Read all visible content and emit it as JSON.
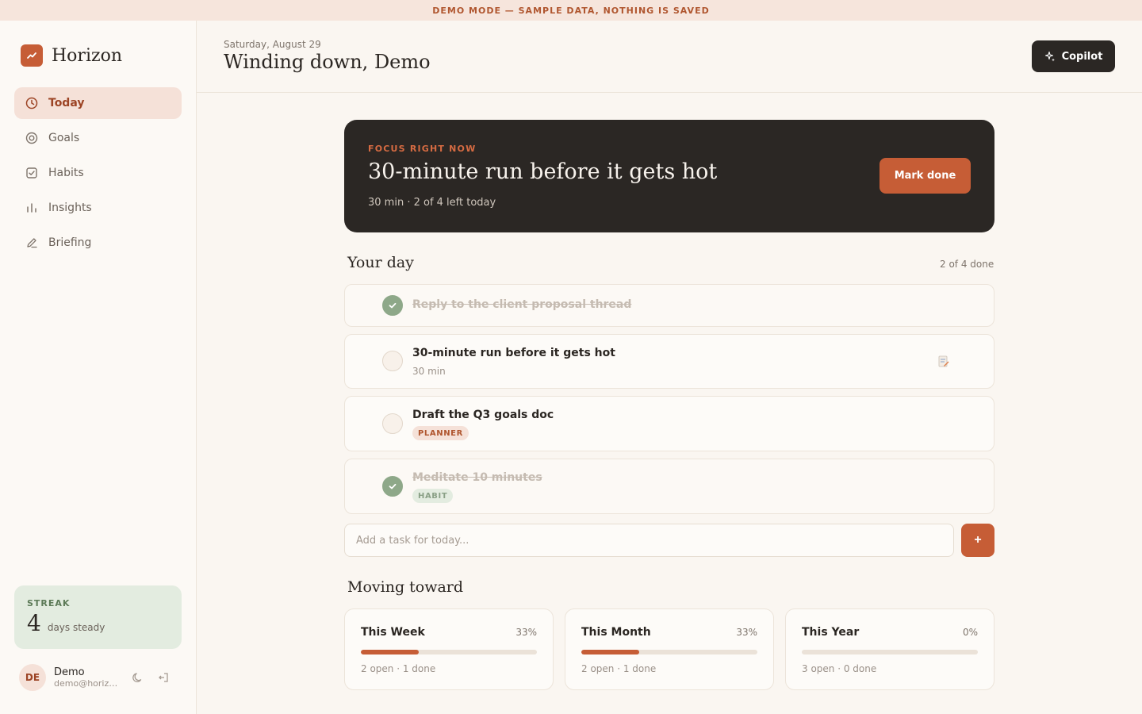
{
  "banner": {
    "text": "DEMO MODE — SAMPLE DATA, NOTHING IS SAVED"
  },
  "brand": {
    "name": "Horizon",
    "color": "#c65d36"
  },
  "nav": [
    {
      "label": "Today",
      "icon": "clock-icon",
      "active": true
    },
    {
      "label": "Goals",
      "icon": "target-icon",
      "active": false
    },
    {
      "label": "Habits",
      "icon": "checkbox-icon",
      "active": false
    },
    {
      "label": "Insights",
      "icon": "bar-chart-icon",
      "active": false
    },
    {
      "label": "Briefing",
      "icon": "pencil-icon",
      "active": false
    }
  ],
  "streak": {
    "label": "STREAK",
    "value": "4",
    "unit": "days steady"
  },
  "user": {
    "initials": "DE",
    "name": "Demo",
    "email": "demo@horizon.app"
  },
  "header": {
    "date": "Saturday, August 29",
    "title": "Winding down, Demo",
    "copilot_label": "Copilot"
  },
  "focus": {
    "label": "FOCUS RIGHT NOW",
    "title": "30-minute run before it gets hot",
    "meta": "30 min · 2 of 4 left today",
    "button": "Mark done"
  },
  "day": {
    "title": "Your day",
    "count": "2 of 4 done",
    "tasks": [
      {
        "text": "Reply to the client proposal thread",
        "done": true
      },
      {
        "text": "30-minute run before it gets hot",
        "sub": "30 min",
        "done": false
      },
      {
        "text": "Draft the Q3 goals doc",
        "tag": "PLANNER",
        "done": false
      },
      {
        "text": "Meditate 10 minutes",
        "tag": "HABIT",
        "done": true
      }
    ],
    "add_placeholder": "Add a task for today...",
    "add_button": "+"
  },
  "moving": {
    "title": "Moving toward",
    "goals": [
      {
        "title": "This Week",
        "pct": "33%",
        "progress": 0.33,
        "meta": "2 open · 1 done"
      },
      {
        "title": "This Month",
        "pct": "33%",
        "progress": 0.33,
        "meta": "2 open · 1 done"
      },
      {
        "title": "This Year",
        "pct": "0%",
        "progress": 0,
        "meta": "3 open · 0 done"
      }
    ]
  }
}
